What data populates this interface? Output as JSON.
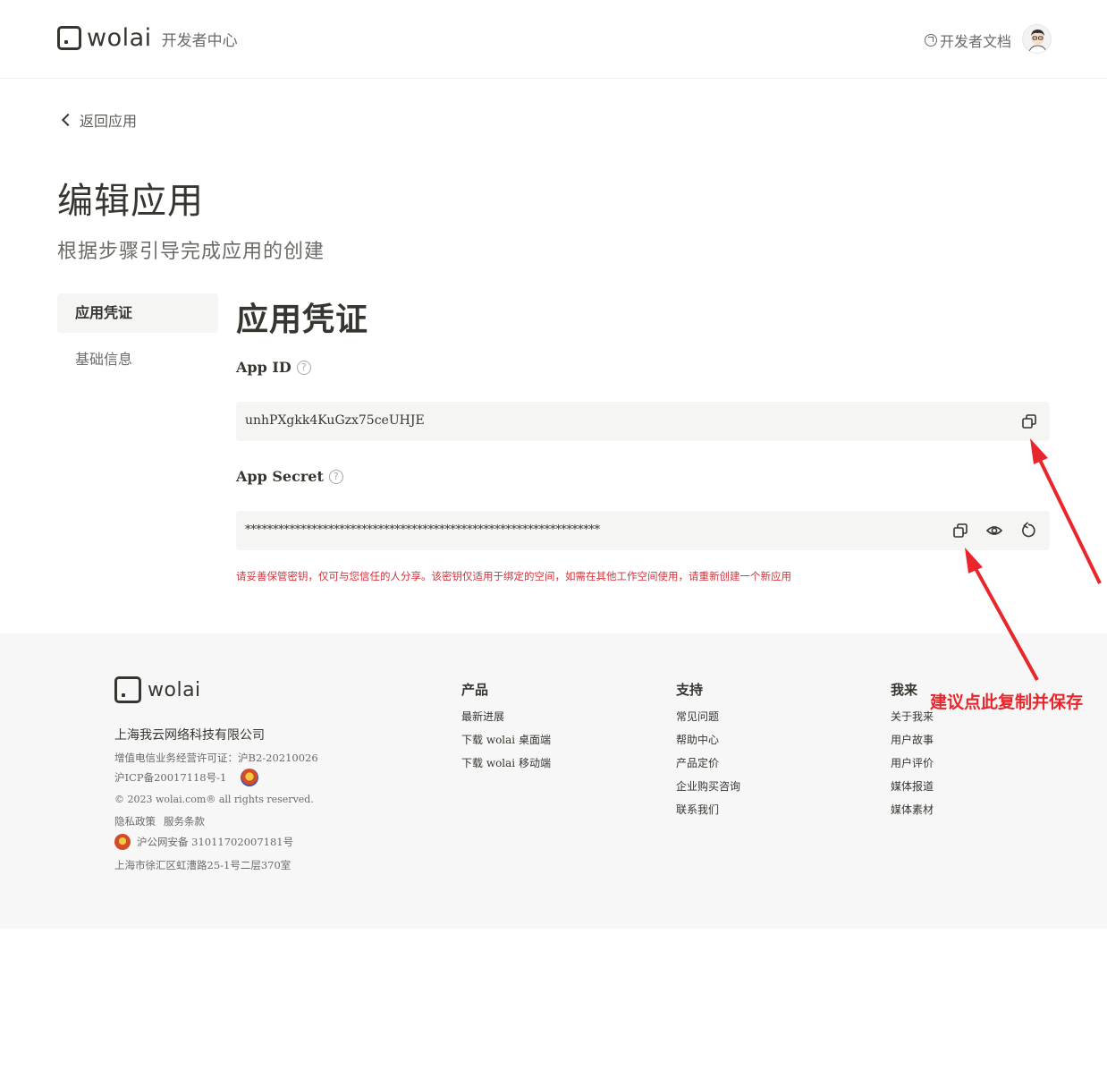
{
  "header": {
    "logo_text": "wolai",
    "subtitle": "开发者中心",
    "docs_link": "开发者文档"
  },
  "back_label": "返回应用",
  "page": {
    "title": "编辑应用",
    "subtitle": "根据步骤引导完成应用的创建"
  },
  "nav": {
    "items": [
      "应用凭证",
      "基础信息"
    ],
    "active": "应用凭证"
  },
  "credentials": {
    "section_title": "应用凭证",
    "app_id_label": "App ID",
    "app_id_value": "unhPXgkk4KuGzx75ceUHJE",
    "app_secret_label": "App Secret",
    "app_secret_value": "****************************************************************",
    "warning": "请妥善保管密钥，仅可与您信任的人分享。该密钥仅适用于绑定的空间，如需在其他工作空间使用，请重新创建一个新应用",
    "icons": [
      "copy-icon",
      "eye-icon",
      "refresh-icon",
      "help-icon"
    ]
  },
  "footer": {
    "logo_text": "wolai",
    "company": "上海我云网络科技有限公司",
    "license": "增值电信业务经营许可证：沪B2-20210026",
    "icp": "沪ICP备20017118号-1",
    "copyright": "© 2023 wolai.com® all rights reserved.",
    "privacy": "隐私政策",
    "terms": "服务条款",
    "police": "沪公网安备 31011702007181号",
    "address": "上海市徐汇区虹漕路25-1号二层370室",
    "columns": [
      {
        "title": "产品",
        "links": [
          "最新进展",
          "下载 wolai 桌面端",
          "下载 wolai 移动端"
        ]
      },
      {
        "title": "支持",
        "links": [
          "常见问题",
          "帮助中心",
          "产品定价",
          "企业购买咨询",
          "联系我们"
        ]
      },
      {
        "title": "我来",
        "links": [
          "关于我来",
          "用户故事",
          "用户评价",
          "媒体报道",
          "媒体素材"
        ]
      }
    ]
  },
  "annotation": {
    "text": "建议点此复制并保存",
    "color": "#e8262b"
  },
  "colors": {
    "text": "#37352f",
    "muted": "#6b6a66",
    "field_bg": "#f5f5f4",
    "footer_bg": "#f7f7f7",
    "warning": "#d0343c"
  }
}
